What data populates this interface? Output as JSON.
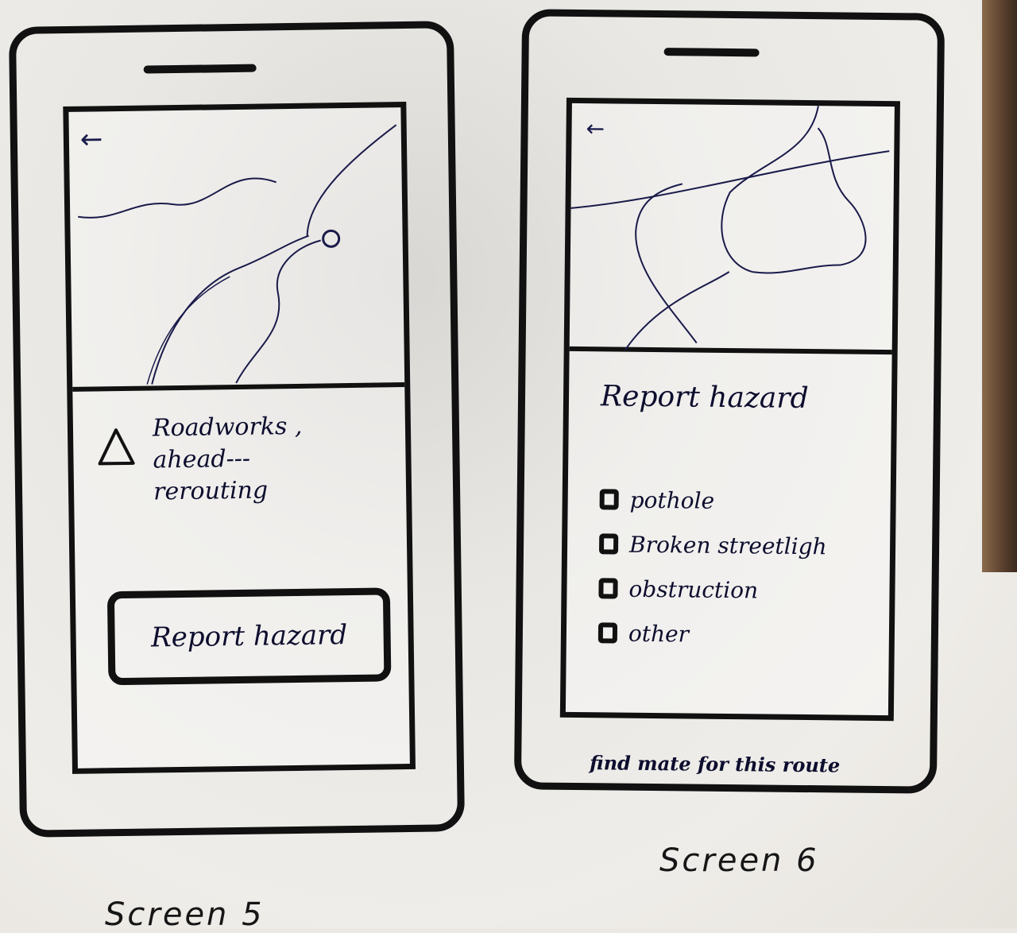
{
  "screen5": {
    "back_icon": "arrow-left-icon",
    "alert_icon": "warning-triangle-icon",
    "alert_lines": [
      "Roadworks ,",
      "ahead---",
      "rerouting"
    ],
    "report_button_label": "Report hazard",
    "caption": "Screen 5"
  },
  "screen6": {
    "back_icon": "arrow-left-icon",
    "title": "Report hazard",
    "options": [
      "pothole",
      "Broken streetligh",
      "obstruction",
      "other"
    ],
    "find_mate_label": "find mate for this route",
    "caption": "Screen 6"
  },
  "colors": {
    "ink": "#111111",
    "pen": "#0d0d2e"
  }
}
